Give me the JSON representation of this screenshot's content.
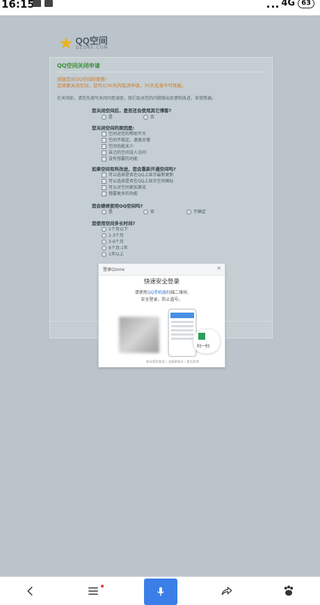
{
  "status": {
    "time": "16:15",
    "network": "4G",
    "battery": "63"
  },
  "logo": {
    "name": "QQ空间",
    "sub": "QZONE.COM"
  },
  "sheet": {
    "title": "QQ空间关闭申请",
    "note1": "感谢您对QQ空间的使用!",
    "note2": "您将要关闭空间，您可以30天内取消申请，30天后将不可恢复。",
    "desc": "在关闭前，请您先填写关闭问卷调查，我们会对您的问题做出反馈和改进，非常感谢。"
  },
  "survey": {
    "q1": "您关闭空间后，是否还会使用其它博客?",
    "q1_options": [
      "是",
      "否"
    ],
    "q2": "您关闭空间的原因是:",
    "q2_options": [
      "空间对您的帮助不大",
      "空间不稳定，速度太慢",
      "空间功能太少",
      "自己的空间没人访问",
      "没有想要的功能"
    ],
    "q3": "如果空间有所改进，您会重新开通空间吗?",
    "q3_options": [
      "可以选择是否在QQ上显示最新更新",
      "可以选择是否在QQ上显示空间图标",
      "可以对空间更加美化",
      "想要更多的功能"
    ],
    "q4": "您会继续使用QQ空间吗?",
    "q4_options": [
      "是",
      "否",
      "不确定"
    ],
    "q5": "您使用空间多长时间?",
    "q5_options": [
      "1个月以下",
      "1-3个月",
      "3-6个月",
      "6个月-1年",
      "1年以上"
    ]
  },
  "modal": {
    "header": "登录Qzone",
    "title": "快速安全登录",
    "line1_prefix": "请使用",
    "line1_link": "QQ手机版",
    "line1_suffix": "扫描二维码,",
    "line2": "安全登录，防止盗号。",
    "scan": "扫一扫",
    "foot": "帐号密码登录 | 注册新帐号 | 意见反馈"
  },
  "icons": {
    "back": "back-arrow-icon",
    "menu": "menu-icon",
    "voice": "microphone-icon",
    "share": "share-icon",
    "paw": "baidu-paw-icon"
  }
}
